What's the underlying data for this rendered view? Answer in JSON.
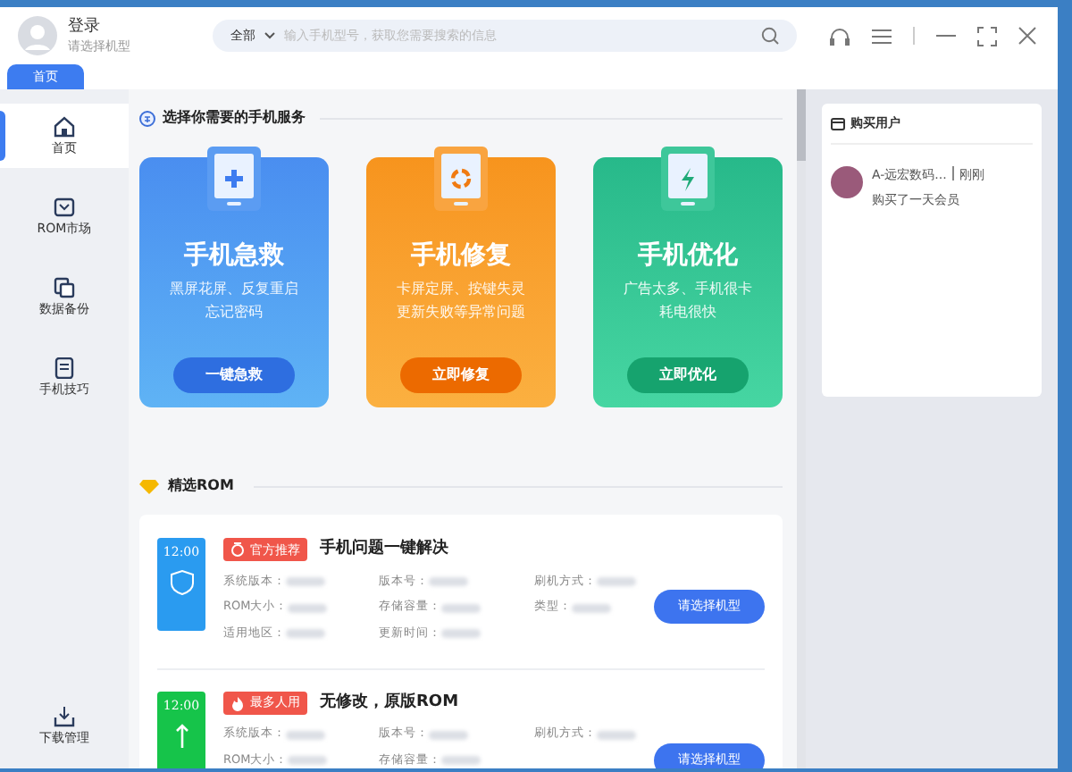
{
  "header": {
    "user_name": "登录",
    "user_hint": "请选择机型",
    "search": {
      "scope": "全部",
      "placeholder": "输入手机型号，获取您需要搜索的信息"
    }
  },
  "tabs": [
    {
      "label": "首页",
      "selected": true
    }
  ],
  "sidebar": {
    "items": [
      {
        "label": "首页",
        "kind": "home",
        "selected": true
      },
      {
        "label": "ROM市场",
        "kind": "market",
        "selected": false
      },
      {
        "label": "数据备份",
        "kind": "backup",
        "selected": false
      },
      {
        "label": "手机技巧",
        "kind": "tips",
        "selected": false
      }
    ],
    "bottom_item": {
      "label": "下载管理",
      "kind": "download",
      "selected": false
    }
  },
  "services": {
    "title": "选择你需要的手机服务",
    "cards": [
      {
        "kind": "rescue",
        "title": "手机急救",
        "lines": [
          "黑屏花屏、反复重启",
          "忘记密码"
        ],
        "button": "一键急救"
      },
      {
        "kind": "repair",
        "title": "手机修复",
        "lines": [
          "卡屏定屏、按键失灵",
          "更新失败等异常问题"
        ],
        "button": "立即修复"
      },
      {
        "kind": "optimize",
        "title": "手机优化",
        "lines": [
          "广告太多、手机很卡",
          "耗电很快"
        ],
        "button": "立即优化"
      }
    ]
  },
  "roms": {
    "title": "精选ROM",
    "items": [
      {
        "kind": "official",
        "badge": "官方推荐",
        "title": "手机问题一键解决",
        "screen_time": "12:00",
        "fields": [
          "系统版本：",
          "版本号：",
          "刷机方式：",
          "ROM大小：",
          "存储容量：",
          "类型：",
          "适用地区：",
          "更新时间："
        ],
        "button": "请选择机型"
      },
      {
        "kind": "popular",
        "badge": "最多人用",
        "title": "无修改，原版ROM",
        "screen_time": "12:00",
        "fields": [
          "系统版本：",
          "版本号：",
          "刷机方式：",
          "ROM大小：",
          "存储容量："
        ],
        "button": "请选择机型"
      }
    ]
  },
  "buyers": {
    "title": "购买用户",
    "entries": [
      {
        "name": "A-远宏数码...",
        "time": "刚刚",
        "action": "购买了一天会员"
      }
    ]
  }
}
